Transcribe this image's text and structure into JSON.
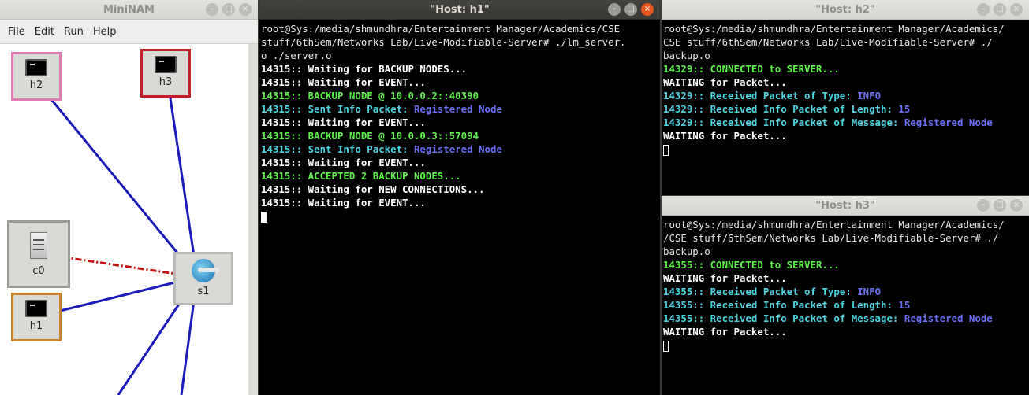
{
  "mininam": {
    "title": "MiniNAM",
    "buttons": {
      "minimize": "–",
      "maximize": "□",
      "close": "×"
    },
    "menu": [
      "File",
      "Edit",
      "Run",
      "Help"
    ],
    "nodes": {
      "h2": "h2",
      "h3": "h3",
      "c0": "c0",
      "s1": "s1",
      "h1": "h1"
    },
    "colors": {
      "h2_border": "#e07ab0",
      "h3_border": "#c0202a",
      "h1_border": "#c8822c",
      "c0_border": "#9a9a96",
      "s1_border": "#b8b8b4",
      "link": "#1a1ab8",
      "control_link": "#c01010"
    }
  },
  "h1": {
    "title": "\"Host: h1\"",
    "buttons": {
      "minimize": "–",
      "maximize": "□",
      "close": "×"
    },
    "lines": [
      {
        "parts": [
          {
            "t": "root@Sys:/media/shmundhra/Entertainment Manager/Academics/CSE",
            "c": ""
          }
        ]
      },
      {
        "parts": [
          {
            "t": "stuff/6thSem/Networks Lab/Live-Modifiable-Server# ./lm_server.",
            "c": ""
          }
        ]
      },
      {
        "parts": [
          {
            "t": "o ./server.o",
            "c": ""
          }
        ]
      },
      {
        "parts": [
          {
            "t": "14315:: Waiting for BACKUP NODES...",
            "c": "white"
          }
        ]
      },
      {
        "parts": [
          {
            "t": "14315:: Waiting for EVENT...",
            "c": "white"
          }
        ]
      },
      {
        "parts": [
          {
            "t": "14315:: BACKUP NODE @ 10.0.0.2::40390",
            "c": "green"
          }
        ]
      },
      {
        "parts": [
          {
            "t": "14315:: Sent Info Packet: ",
            "c": "cyan"
          },
          {
            "t": "Registered Node",
            "c": "blue"
          }
        ]
      },
      {
        "parts": [
          {
            "t": "14315:: Waiting for EVENT...",
            "c": "white"
          }
        ]
      },
      {
        "parts": [
          {
            "t": "14315:: BACKUP NODE @ 10.0.0.3::57094",
            "c": "green"
          }
        ]
      },
      {
        "parts": [
          {
            "t": "14315:: Sent Info Packet: ",
            "c": "cyan"
          },
          {
            "t": "Registered Node",
            "c": "blue"
          }
        ]
      },
      {
        "parts": [
          {
            "t": "14315:: Waiting for EVENT...",
            "c": "white"
          }
        ]
      },
      {
        "parts": [
          {
            "t": "14315:: ACCEPTED 2 BACKUP NODES...",
            "c": "green"
          }
        ]
      },
      {
        "parts": [
          {
            "t": "14315:: Waiting for NEW CONNECTIONS...",
            "c": "white"
          }
        ]
      },
      {
        "parts": [
          {
            "t": "14315:: Waiting for EVENT...",
            "c": "white"
          }
        ]
      }
    ]
  },
  "h2": {
    "title": "\"Host: h2\"",
    "buttons": {
      "minimize": "–",
      "maximize": "□",
      "close": "×"
    },
    "lines": [
      {
        "parts": [
          {
            "t": "root@Sys:/media/shmundhra/Entertainment Manager/Academics/",
            "c": ""
          }
        ]
      },
      {
        "parts": [
          {
            "t": "CSE stuff/6thSem/Networks Lab/Live-Modifiable-Server# ./",
            "c": ""
          }
        ]
      },
      {
        "parts": [
          {
            "t": "backup.o",
            "c": ""
          }
        ]
      },
      {
        "parts": [
          {
            "t": "14329:: CONNECTED to SERVER...",
            "c": "green"
          }
        ]
      },
      {
        "parts": [
          {
            "t": "WAITING for Packet...",
            "c": "white"
          }
        ]
      },
      {
        "parts": [
          {
            "t": "14329:: Received Packet of Type: ",
            "c": "cyan"
          },
          {
            "t": "INFO",
            "c": "blue"
          }
        ]
      },
      {
        "parts": [
          {
            "t": "14329:: Received Info Packet of Length: ",
            "c": "cyan"
          },
          {
            "t": "15",
            "c": "blue"
          }
        ]
      },
      {
        "parts": [
          {
            "t": "14329:: Received Info Packet of Message: ",
            "c": "cyan"
          },
          {
            "t": "Registered Node",
            "c": "blue"
          }
        ]
      },
      {
        "parts": [
          {
            "t": "WAITING for Packet...",
            "c": "white"
          }
        ]
      }
    ]
  },
  "h3": {
    "title": "\"Host: h3\"",
    "buttons": {
      "minimize": "–",
      "maximize": "□",
      "close": "×"
    },
    "lines": [
      {
        "parts": [
          {
            "t": "root@Sys:/media/shmundhra/Entertainment Manager/Academics/",
            "c": ""
          }
        ]
      },
      {
        "parts": [
          {
            "t": "/CSE stuff/6thSem/Networks Lab/Live-Modifiable-Server# ./",
            "c": ""
          }
        ]
      },
      {
        "parts": [
          {
            "t": "backup.o",
            "c": ""
          }
        ]
      },
      {
        "parts": [
          {
            "t": "14355:: CONNECTED to SERVER...",
            "c": "green"
          }
        ]
      },
      {
        "parts": [
          {
            "t": "WAITING for Packet...",
            "c": "white"
          }
        ]
      },
      {
        "parts": [
          {
            "t": "14355:: Received Packet of Type: ",
            "c": "cyan"
          },
          {
            "t": "INFO",
            "c": "blue"
          }
        ]
      },
      {
        "parts": [
          {
            "t": "14355:: Received Info Packet of Length: ",
            "c": "cyan"
          },
          {
            "t": "15",
            "c": "blue"
          }
        ]
      },
      {
        "parts": [
          {
            "t": "14355:: Received Info Packet of Message: ",
            "c": "cyan"
          },
          {
            "t": "Registered Node",
            "c": "blue"
          }
        ]
      },
      {
        "parts": [
          {
            "t": "WAITING for Packet...",
            "c": "white"
          }
        ]
      }
    ]
  }
}
